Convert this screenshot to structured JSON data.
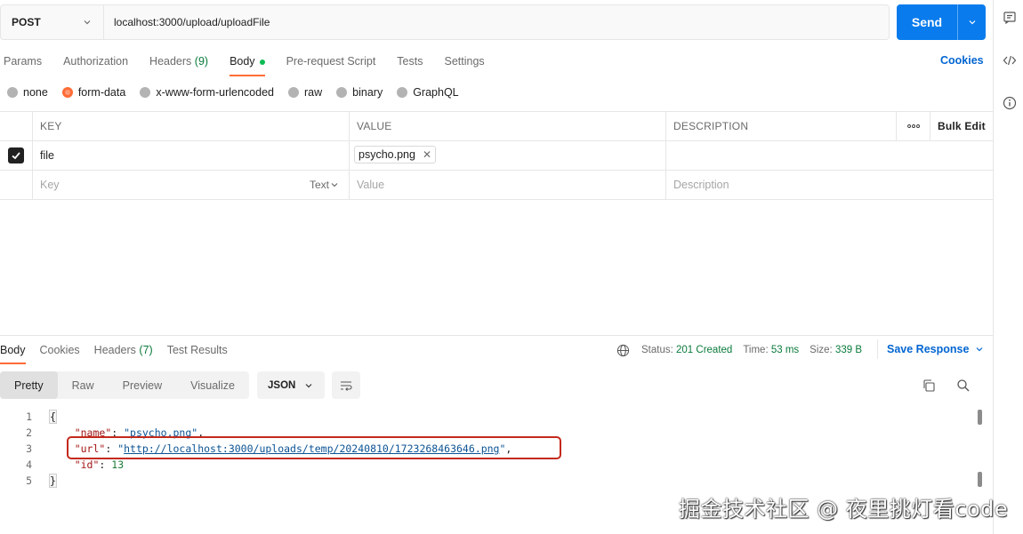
{
  "request": {
    "method": "POST",
    "url": "localhost:3000/upload/uploadFile",
    "send_label": "Send"
  },
  "req_tabs": [
    {
      "label": "Params",
      "count": "",
      "active": false
    },
    {
      "label": "Authorization",
      "count": "",
      "active": false
    },
    {
      "label": "Headers",
      "count": "(9)",
      "active": false
    },
    {
      "label": "Body",
      "count": "",
      "active": true
    },
    {
      "label": "Pre-request Script",
      "count": "",
      "active": false
    },
    {
      "label": "Tests",
      "count": "",
      "active": false
    },
    {
      "label": "Settings",
      "count": "",
      "active": false
    }
  ],
  "cookies_label": "Cookies",
  "body_types": [
    "none",
    "form-data",
    "x-www-form-urlencoded",
    "raw",
    "binary",
    "GraphQL"
  ],
  "selected_body_type": "form-data",
  "kv_table": {
    "headers": {
      "key": "KEY",
      "value": "VALUE",
      "description": "DESCRIPTION",
      "bulk_edit": "Bulk Edit"
    },
    "row": {
      "key": "file",
      "value": "psycho.png"
    },
    "placeholder": {
      "key": "Key",
      "type": "Text",
      "value": "Value",
      "description": "Description"
    }
  },
  "resp_tabs": [
    {
      "label": "Body",
      "count": "",
      "active": true
    },
    {
      "label": "Cookies",
      "count": "",
      "active": false
    },
    {
      "label": "Headers",
      "count": "(7)",
      "active": false
    },
    {
      "label": "Test Results",
      "count": "",
      "active": false
    }
  ],
  "status": {
    "status_label": "Status:",
    "status_value": "201 Created",
    "time_label": "Time:",
    "time_value": "53 ms",
    "size_label": "Size:",
    "size_value": "339 B"
  },
  "save_response_label": "Save Response",
  "view_tabs": [
    "Pretty",
    "Raw",
    "Preview",
    "Visualize"
  ],
  "format": "JSON",
  "code": {
    "line_numbers": [
      "1",
      "2",
      "3",
      "4",
      "5"
    ],
    "open_brace": "{",
    "close_brace": "}",
    "name_key": "\"name\"",
    "name_value": "\"psycho.png\"",
    "url_key": "\"url\"",
    "url_value": "http://localhost:3000/uploads/temp/20240810/1723268463646.png",
    "id_key": "\"id\"",
    "id_value": "13"
  },
  "watermark": "掘金技术社区 @ 夜里挑灯看code",
  "colors": {
    "accent": "#ff6c37",
    "send": "#097bed",
    "link": "#0265d2",
    "status_ok": "#0a7a3b",
    "highlight": "#c3291c"
  }
}
